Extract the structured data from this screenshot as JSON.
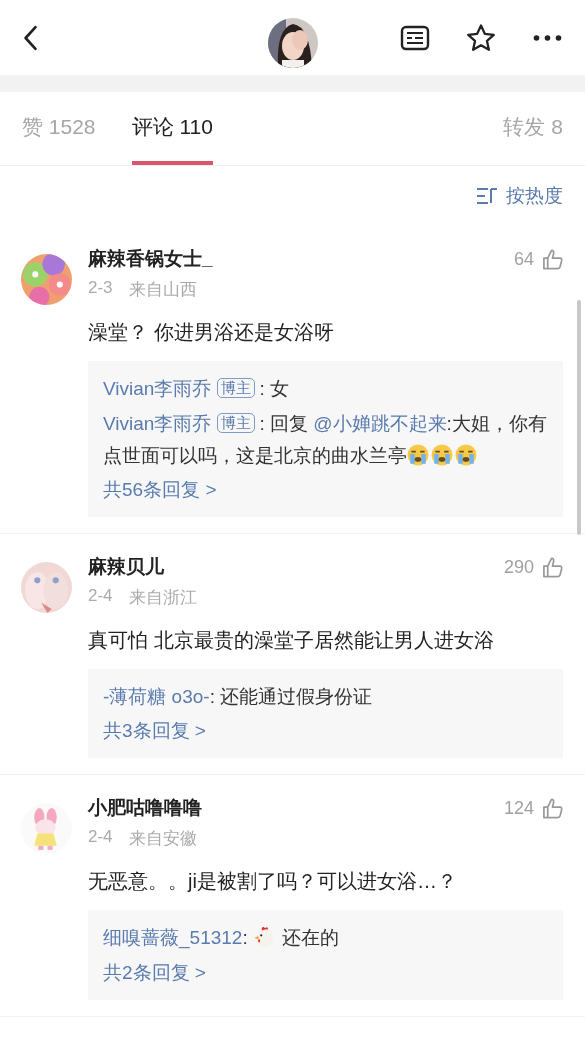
{
  "tabs": [
    {
      "label": "赞 1528",
      "selected": false
    },
    {
      "label": "评论 110",
      "selected": true
    },
    {
      "label": "转发 8",
      "selected": false
    }
  ],
  "sort": {
    "label": "按热度"
  },
  "comments": [
    {
      "name": "麻辣香锅女士_",
      "date": "2-3",
      "location": "来自山西",
      "likes": "64",
      "text": "澡堂？ 你进男浴还是女浴呀",
      "replies": [
        {
          "author": "Vivian李雨乔",
          "badge": "博主",
          "prefix": ": 女"
        },
        {
          "author": "Vivian李雨乔",
          "badge": "博主",
          "prefix": ": 回复 ",
          "mention": "@小婵跳不起来",
          "text": ":大姐，你有点世面可以吗，这是北京的曲水兰亭",
          "emojis": [
            {
              "kind": "crying"
            },
            {
              "kind": "crying"
            },
            {
              "kind": "crying"
            }
          ]
        }
      ],
      "more": "共56条回复 >"
    },
    {
      "name": "麻辣贝儿",
      "date": "2-4",
      "location": "来自浙江",
      "likes": "290",
      "text": "真可怕 北京最贵的澡堂子居然能让男人进女浴",
      "replies": [
        {
          "author": "-薄荷糖 o3o-",
          "prefix": ": 还能通过假身份证"
        }
      ],
      "more": "共3条回复 >"
    },
    {
      "name": "小肥咕噜噜噜",
      "date": "2-4",
      "location": "来自安徽",
      "likes": "124",
      "text": "无恶意。。ji是被割了吗？可以进女浴…？",
      "replies": [
        {
          "author": "细嗅蔷薇_51312",
          "prefix": ": ",
          "emojis": [
            {
              "kind": "chicken"
            }
          ],
          "text": " 还在的"
        }
      ],
      "more": "共2条回复 >"
    }
  ]
}
